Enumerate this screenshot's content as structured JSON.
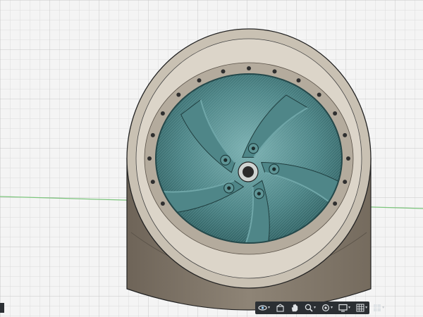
{
  "app": {
    "name": "3D CAD viewport",
    "background_color": "#f4f4f4",
    "grid_color": "#d6d6d6",
    "grid_major_color": "#c3c3c3",
    "x_axis_color": "#6fbf6f"
  },
  "model": {
    "name": "wheel-rim",
    "barrel_color": "#857a6c",
    "barrel_inner_color": "#c5bdb0",
    "face_color": "#4f8688",
    "face_highlight_color": "#6fa6a8",
    "hub_color": "#2f2f2f",
    "spoke_count": 5,
    "lug_count": 5,
    "rivet_count": 24
  },
  "navbar": {
    "tools": [
      {
        "name": "orbit-tool",
        "icon": "orbit-icon",
        "has_menu": true
      },
      {
        "name": "look-at-tool",
        "icon": "look-at-icon",
        "has_menu": false
      },
      {
        "name": "pan-tool",
        "icon": "pan-hand-icon",
        "has_menu": false
      },
      {
        "name": "zoom-tool",
        "icon": "zoom-icon",
        "has_menu": true
      },
      {
        "name": "fit-tool",
        "icon": "fit-icon",
        "has_menu": true
      },
      {
        "name": "display-settings-tool",
        "icon": "display-settings-icon",
        "has_menu": true
      },
      {
        "name": "grid-settings-tool",
        "icon": "grid-icon",
        "has_menu": true
      },
      {
        "name": "viewports-tool",
        "icon": "viewports-icon",
        "has_menu": true
      }
    ]
  }
}
